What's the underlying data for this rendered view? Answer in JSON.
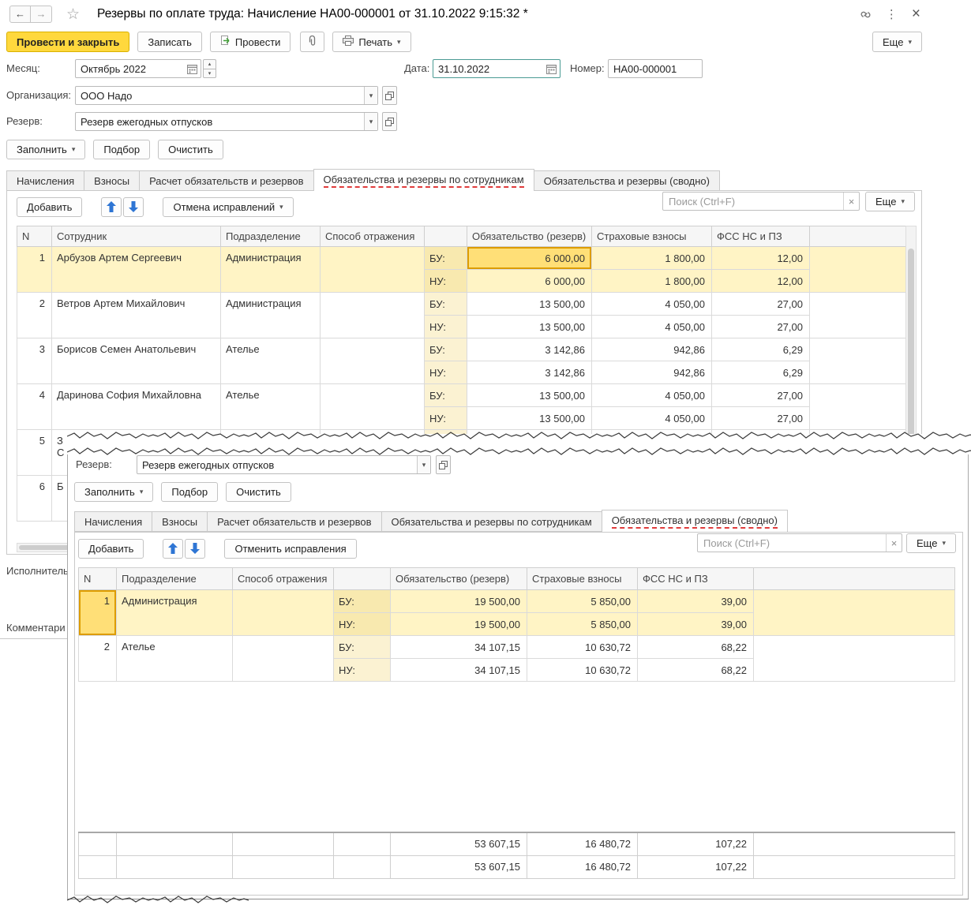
{
  "ui": {
    "caret": "▾",
    "spin_up": "▴",
    "spin_down": "▾",
    "clear_x": "×"
  },
  "w1": {
    "title": "Резервы по оплате труда: Начисление НА00-000001 от 31.10.2022 9:15:32 *",
    "titlebar": {
      "back": "←",
      "forward": "→",
      "star": "☆",
      "menu_dots": "⋮",
      "close": "×"
    },
    "cmd": {
      "post_close": "Провести и закрыть",
      "write": "Записать",
      "post": "Провести",
      "print": "Печать",
      "more": "Еще"
    },
    "form": {
      "month_label": "Месяц:",
      "month_value": "Октябрь 2022",
      "date_label": "Дата:",
      "date_value": "31.10.2022",
      "number_label": "Номер:",
      "number_value": "НА00-000001",
      "org_label": "Организация:",
      "org_value": "ООО Надо",
      "reserve_label": "Резерв:",
      "reserve_value": "Резерв ежегодных отпусков",
      "fill": "Заполнить",
      "pick": "Подбор",
      "clear": "Очистить"
    },
    "tabs": [
      "Начисления",
      "Взносы",
      "Расчет обязательств и резервов",
      "Обязательства и резервы по сотрудникам",
      "Обязательства и резервы (сводно)"
    ],
    "grid": {
      "add": "Добавить",
      "undo": "Отмена исправлений",
      "search_placeholder": "Поиск (Ctrl+F)",
      "more": "Еще",
      "headers": {
        "n": "N",
        "employee": "Сотрудник",
        "dept": "Подразделение",
        "method": "Способ отражения",
        "liability": "Обязательство (резерв)",
        "insurance": "Страховые взносы",
        "fss": "ФСС НС и ПЗ"
      },
      "bu": "БУ:",
      "nu": "НУ:",
      "rows": [
        {
          "n": "1",
          "name": "Арбузов Артем Сергеевич",
          "dept": "Администрация",
          "bu": [
            "6 000,00",
            "1 800,00",
            "12,00"
          ],
          "nu": [
            "6 000,00",
            "1 800,00",
            "12,00"
          ]
        },
        {
          "n": "2",
          "name": "Ветров Артем Михайлович",
          "dept": "Администрация",
          "bu": [
            "13 500,00",
            "4 050,00",
            "27,00"
          ],
          "nu": [
            "13 500,00",
            "4 050,00",
            "27,00"
          ]
        },
        {
          "n": "3",
          "name": "Борисов Семен Анатольевич",
          "dept": "Ателье",
          "bu": [
            "3 142,86",
            "942,86",
            "6,29"
          ],
          "nu": [
            "3 142,86",
            "942,86",
            "6,29"
          ]
        },
        {
          "n": "4",
          "name": "Даринова София Михайловна",
          "dept": "Ателье",
          "bu": [
            "13 500,00",
            "4 050,00",
            "27,00"
          ],
          "nu": [
            "13 500,00",
            "4 050,00",
            "27,00"
          ]
        },
        {
          "n": "5",
          "name": "З",
          "name2": "С",
          "dept": "",
          "bu": [
            "",
            "",
            ""
          ],
          "nu": [
            "",
            "",
            ""
          ]
        },
        {
          "n": "6",
          "name": "Б",
          "dept": "",
          "bu": [
            "",
            "",
            ""
          ],
          "nu": [
            "",
            "",
            ""
          ]
        }
      ]
    },
    "footer_labels": {
      "executor": "Исполнитель",
      "comment": "Комментари"
    }
  },
  "w2": {
    "form": {
      "reserve_label": "Резерв:",
      "reserve_value": "Резерв ежегодных отпусков",
      "fill": "Заполнить",
      "pick": "Подбор",
      "clear": "Очистить"
    },
    "tabs": [
      "Начисления",
      "Взносы",
      "Расчет обязательств и резервов",
      "Обязательства и резервы по сотрудникам",
      "Обязательства и резервы (сводно)"
    ],
    "grid": {
      "add": "Добавить",
      "undo": "Отменить исправления",
      "search_placeholder": "Поиск (Ctrl+F)",
      "more": "Еще",
      "headers": {
        "n": "N",
        "dept": "Подразделение",
        "method": "Способ отражения",
        "liability": "Обязательство (резерв)",
        "insurance": "Страховые взносы",
        "fss": "ФСС НС и ПЗ"
      },
      "bu": "БУ:",
      "nu": "НУ:",
      "rows": [
        {
          "n": "1",
          "dept": "Администрация",
          "bu": [
            "19 500,00",
            "5 850,00",
            "39,00"
          ],
          "nu": [
            "19 500,00",
            "5 850,00",
            "39,00"
          ]
        },
        {
          "n": "2",
          "dept": "Ателье",
          "bu": [
            "34 107,15",
            "10 630,72",
            "68,22"
          ],
          "nu": [
            "34 107,15",
            "10 630,72",
            "68,22"
          ]
        }
      ],
      "totals": {
        "bu": [
          "53 607,15",
          "16 480,72",
          "107,22"
        ],
        "nu": [
          "53 607,15",
          "16 480,72",
          "107,22"
        ]
      }
    }
  }
}
